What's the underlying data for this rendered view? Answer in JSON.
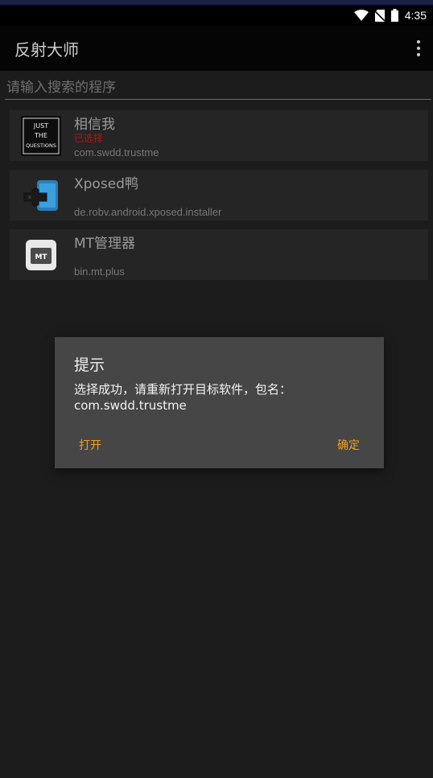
{
  "status_bar": {
    "time": "4:35",
    "icons": [
      "wifi-icon",
      "no-sim-icon",
      "battery-icon"
    ]
  },
  "app_bar": {
    "title": "反射大师",
    "menu_icon": "overflow-menu-icon"
  },
  "search": {
    "placeholder": "请输入搜索的程序",
    "value": ""
  },
  "apps": [
    {
      "name": "相信我",
      "tag": "已选择",
      "package": "com.swdd.trustme",
      "icon": "just-the-questions-icon"
    },
    {
      "name": "Xposed鸭",
      "tag": "",
      "package": "de.robv.android.xposed.installer",
      "icon": "xposed-puzzle-icon"
    },
    {
      "name": "MT管理器",
      "tag": "",
      "package": "bin.mt.plus",
      "icon": "mt-manager-icon"
    }
  ],
  "icon_texts": {
    "jtq_line1": "JUST",
    "jtq_line2": "THE",
    "jtq_line3": "QUESTIONS",
    "mt": "MT"
  },
  "dialog": {
    "title": "提示",
    "message": "选择成功，请重新打开目标软件，包名：com.swdd.trustme",
    "negative_label": "打开",
    "positive_label": "确定"
  },
  "colors": {
    "accent": "#f0a020",
    "selected_tag": "#c01010",
    "background": "#1c1c1c",
    "dialog_bg": "#464646"
  }
}
